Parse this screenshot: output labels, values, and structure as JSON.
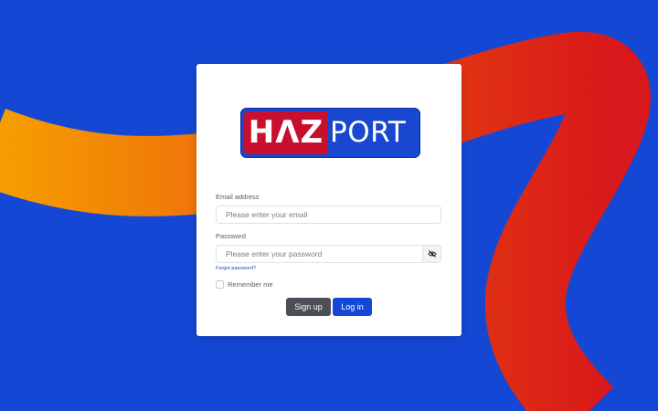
{
  "colors": {
    "background": "#1448d4",
    "swoosh_orange": "#f6a000",
    "swoosh_red": "#d8241a",
    "brand_red": "#c8102e",
    "brand_blue": "#1a47cf",
    "signup_button": "#4a5055",
    "login_button": "#1448d4"
  },
  "logo": {
    "part1": "HΛZ",
    "part2": "PORT"
  },
  "form": {
    "email": {
      "label": "Email address",
      "placeholder": "Please enter your email",
      "value": ""
    },
    "password": {
      "label": "Password",
      "placeholder": "Please enter your password",
      "value": "",
      "toggle_icon": "eye-slash-icon"
    },
    "forgot_link": "Forgot password?",
    "remember_label": "Remember me",
    "remember_checked": false
  },
  "buttons": {
    "signup": "Sign up",
    "login": "Log in"
  }
}
